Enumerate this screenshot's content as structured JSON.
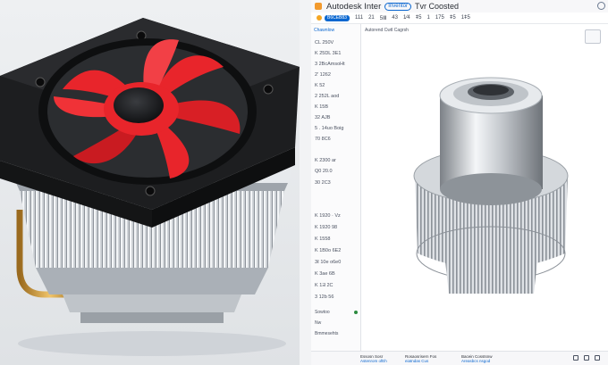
{
  "app": {
    "title": "Autodesk Inter",
    "tag": "Inventor",
    "doc_title": "Tvr Coosted"
  },
  "toolbar": {
    "badge": "B6CEB83",
    "items": [
      "111",
      "21",
      "5Ⅲ",
      "43",
      "1⁄4",
      "ǂ5",
      "1",
      "175",
      "ǂ5",
      "1ǂ5"
    ]
  },
  "sidebar": {
    "header": "Chawnlow",
    "rows": [
      "CL 250V",
      "K 25DL 3E1",
      "3 2BcAmsoHt",
      "2' 1262",
      "K 52",
      "2 252L aod",
      "K 15B",
      "32 AJB",
      "5 . 14uo Boig",
      "70 8C6",
      "K 2300 ar",
      "Q0 20.0",
      "30 2C3",
      "",
      "K 1920 · Vz",
      "K 1920 98",
      "K 1558",
      "K 1B0o 6E2",
      "3ℓ 10e o6e0",
      "K 3ae 6B",
      "K 1Ǝ 2C",
      "3 12b 56"
    ],
    "options": [
      "Sowtoo",
      "Nw",
      "Bmmesehts"
    ]
  },
  "canvas": {
    "breadcrumb": "Autorend Cwtl Cagrsh"
  },
  "status": [
    {
      "label": "Essosn Sosr",
      "sub": "Astenrom ofEh"
    },
    {
      "label": "Rosaosrisern Fos",
      "sub": "eiatndas Cus"
    },
    {
      "label": "Bacein Cosstsnw",
      "sub": "Areasbcs nsgod"
    }
  ],
  "colors": {
    "accent": "#0b67d0",
    "fan_red": "#e8252b",
    "logo": "#f29a2e"
  },
  "photo": {
    "subject": "cpu-cooler-photo"
  }
}
